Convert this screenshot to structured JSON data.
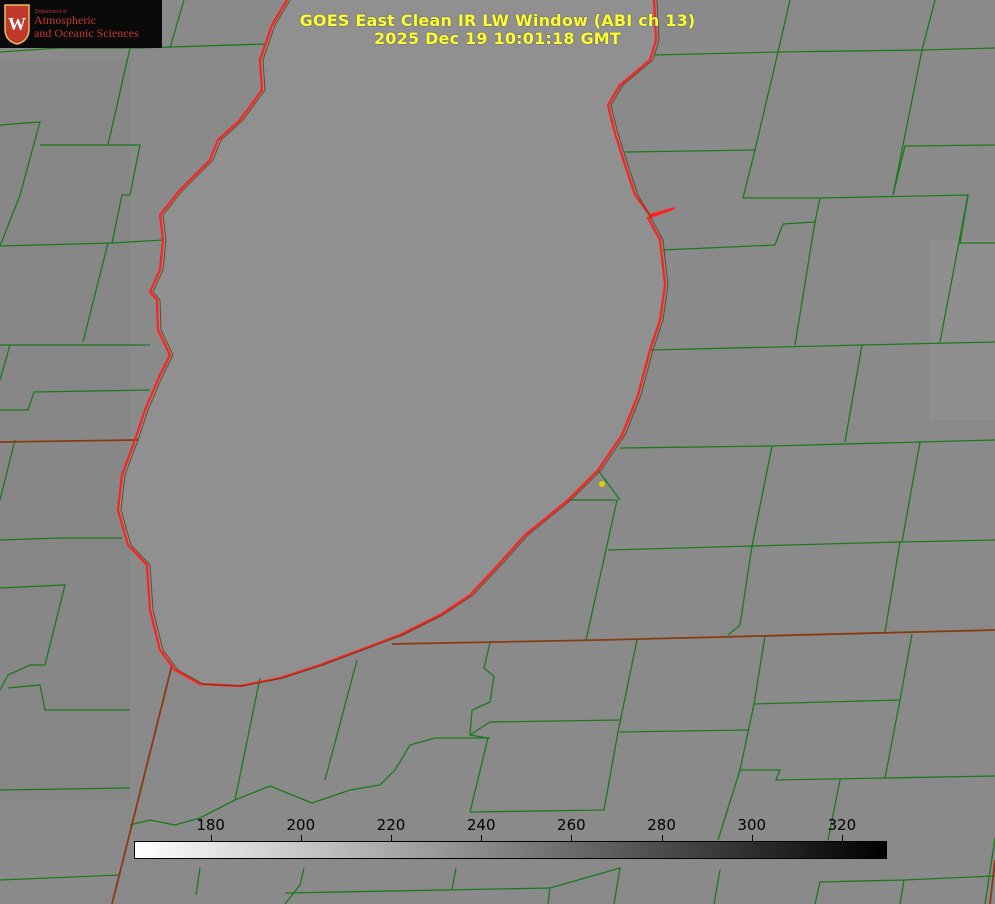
{
  "title": {
    "line1": "GOES East Clean IR LW Window (ABI ch 13)",
    "line2": "2025 Dec 19 10:01:18 GMT"
  },
  "logo": {
    "department": "Department of",
    "line1": "Atmospheric",
    "line2": "and Oceanic Sciences",
    "crest_letter": "W",
    "crest_color": "#c0392b"
  },
  "colorbar": {
    "ticks": [
      "180",
      "200",
      "220",
      "240",
      "260",
      "280",
      "300",
      "320"
    ],
    "tick_values": [
      180,
      200,
      220,
      240,
      260,
      280,
      300,
      320
    ],
    "range": [
      163,
      330
    ],
    "gradient": "white-to-black"
  },
  "colors": {
    "background": "#8a8a8a",
    "lake": "#8f8f8f",
    "county_lines": "#1a7a1a",
    "state_lines": "#8b3a10",
    "shoreline": "#ff2020",
    "title_text": "#ffff33",
    "marker": "#e0d000"
  },
  "map": {
    "feature": "lake-michigan-shoreline",
    "marker": "city-dot"
  }
}
